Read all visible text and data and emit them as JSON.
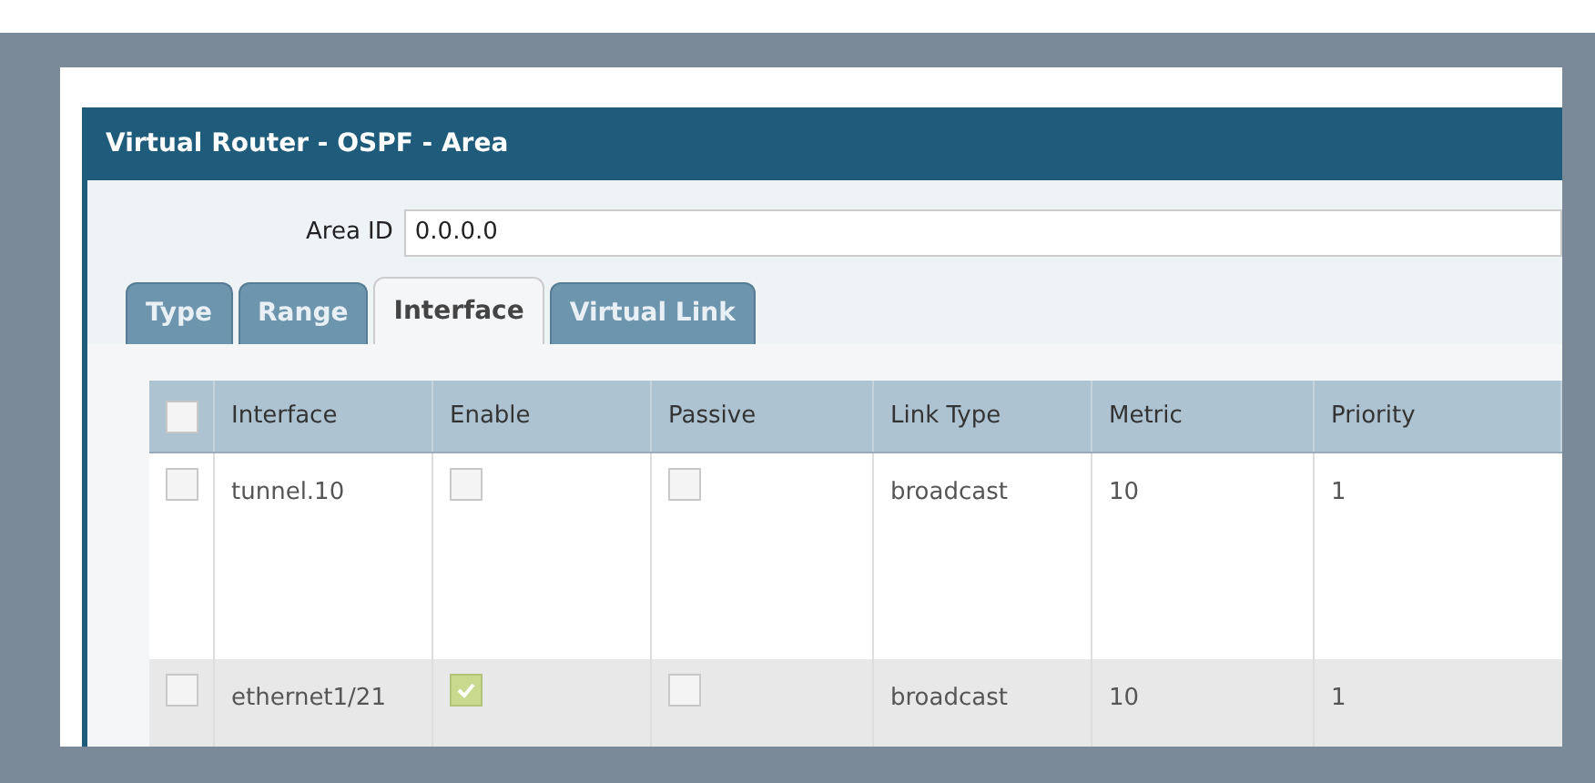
{
  "dialog": {
    "title": "Virtual Router - OSPF - Area"
  },
  "area_id": {
    "label": "Area ID",
    "value": "0.0.0.0"
  },
  "tabs": [
    {
      "label": "Type",
      "selected": false
    },
    {
      "label": "Range",
      "selected": false
    },
    {
      "label": "Interface",
      "selected": true
    },
    {
      "label": "Virtual Link",
      "selected": false
    }
  ],
  "table": {
    "header_checked": false,
    "columns": [
      "Interface",
      "Enable",
      "Passive",
      "Link Type",
      "Metric",
      "Priority"
    ],
    "rows": [
      {
        "checked": false,
        "interface": "tunnel.10",
        "enable": false,
        "passive": false,
        "link_type": "broadcast",
        "metric": "10",
        "priority": "1"
      },
      {
        "checked": false,
        "interface": "ethernet1/21",
        "enable": true,
        "passive": false,
        "link_type": "broadcast",
        "metric": "10",
        "priority": "1"
      }
    ]
  }
}
